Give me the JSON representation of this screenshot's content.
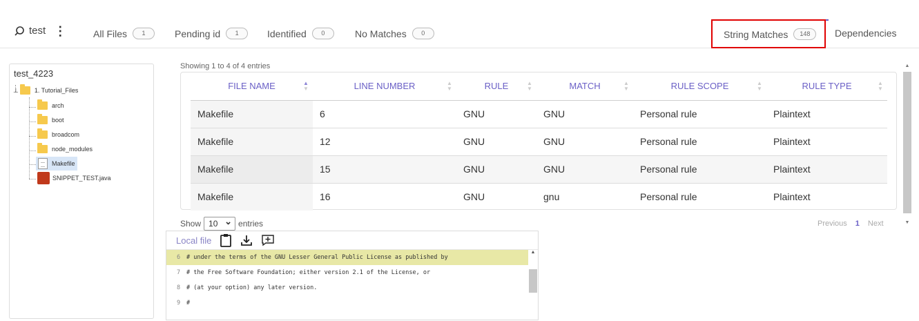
{
  "project": {
    "name": "test"
  },
  "tabs": [
    {
      "label": "All Files",
      "count": "1"
    },
    {
      "label": "Pending id",
      "count": "1"
    },
    {
      "label": "Identified",
      "count": "0"
    },
    {
      "label": "No Matches",
      "count": "0"
    },
    {
      "label": "String Matches",
      "count": "148"
    },
    {
      "label": "Dependencies"
    }
  ],
  "tree": {
    "root": "test_4223",
    "folder": "1. Tutorial_Files",
    "children": [
      "arch",
      "boot",
      "broadcom",
      "node_modules",
      "Makefile",
      "SNIPPET_TEST.java"
    ]
  },
  "table": {
    "info": "Showing 1 to 4 of 4 entries",
    "columns": [
      "FILE NAME",
      "LINE NUMBER",
      "RULE",
      "MATCH",
      "RULE SCOPE",
      "RULE TYPE"
    ],
    "rows": [
      [
        "Makefile",
        "6",
        "GNU",
        "GNU",
        "Personal rule",
        "Plaintext"
      ],
      [
        "Makefile",
        "12",
        "GNU",
        "GNU",
        "Personal rule",
        "Plaintext"
      ],
      [
        "Makefile",
        "15",
        "GNU",
        "GNU",
        "Personal rule",
        "Plaintext"
      ],
      [
        "Makefile",
        "16",
        "GNU",
        "gnu",
        "Personal rule",
        "Plaintext"
      ]
    ],
    "show_label": "Show",
    "show_value": "10",
    "entries_label": "entries",
    "pager": {
      "prev": "Previous",
      "page": "1",
      "next": "Next"
    }
  },
  "code": {
    "title": "Local file",
    "lines": [
      {
        "n": "6",
        "text": "#  under the terms of the GNU Lesser General Public License as published by"
      },
      {
        "n": "7",
        "text": "#  the Free Software Foundation; either version 2.1 of the License, or"
      },
      {
        "n": "8",
        "text": "#  (at your option) any later version."
      },
      {
        "n": "9",
        "text": "#"
      }
    ]
  },
  "colors": {
    "accent": "#6a5fc6",
    "highlight_box": "#e00000",
    "code_highlight": "#e8e8a6"
  }
}
